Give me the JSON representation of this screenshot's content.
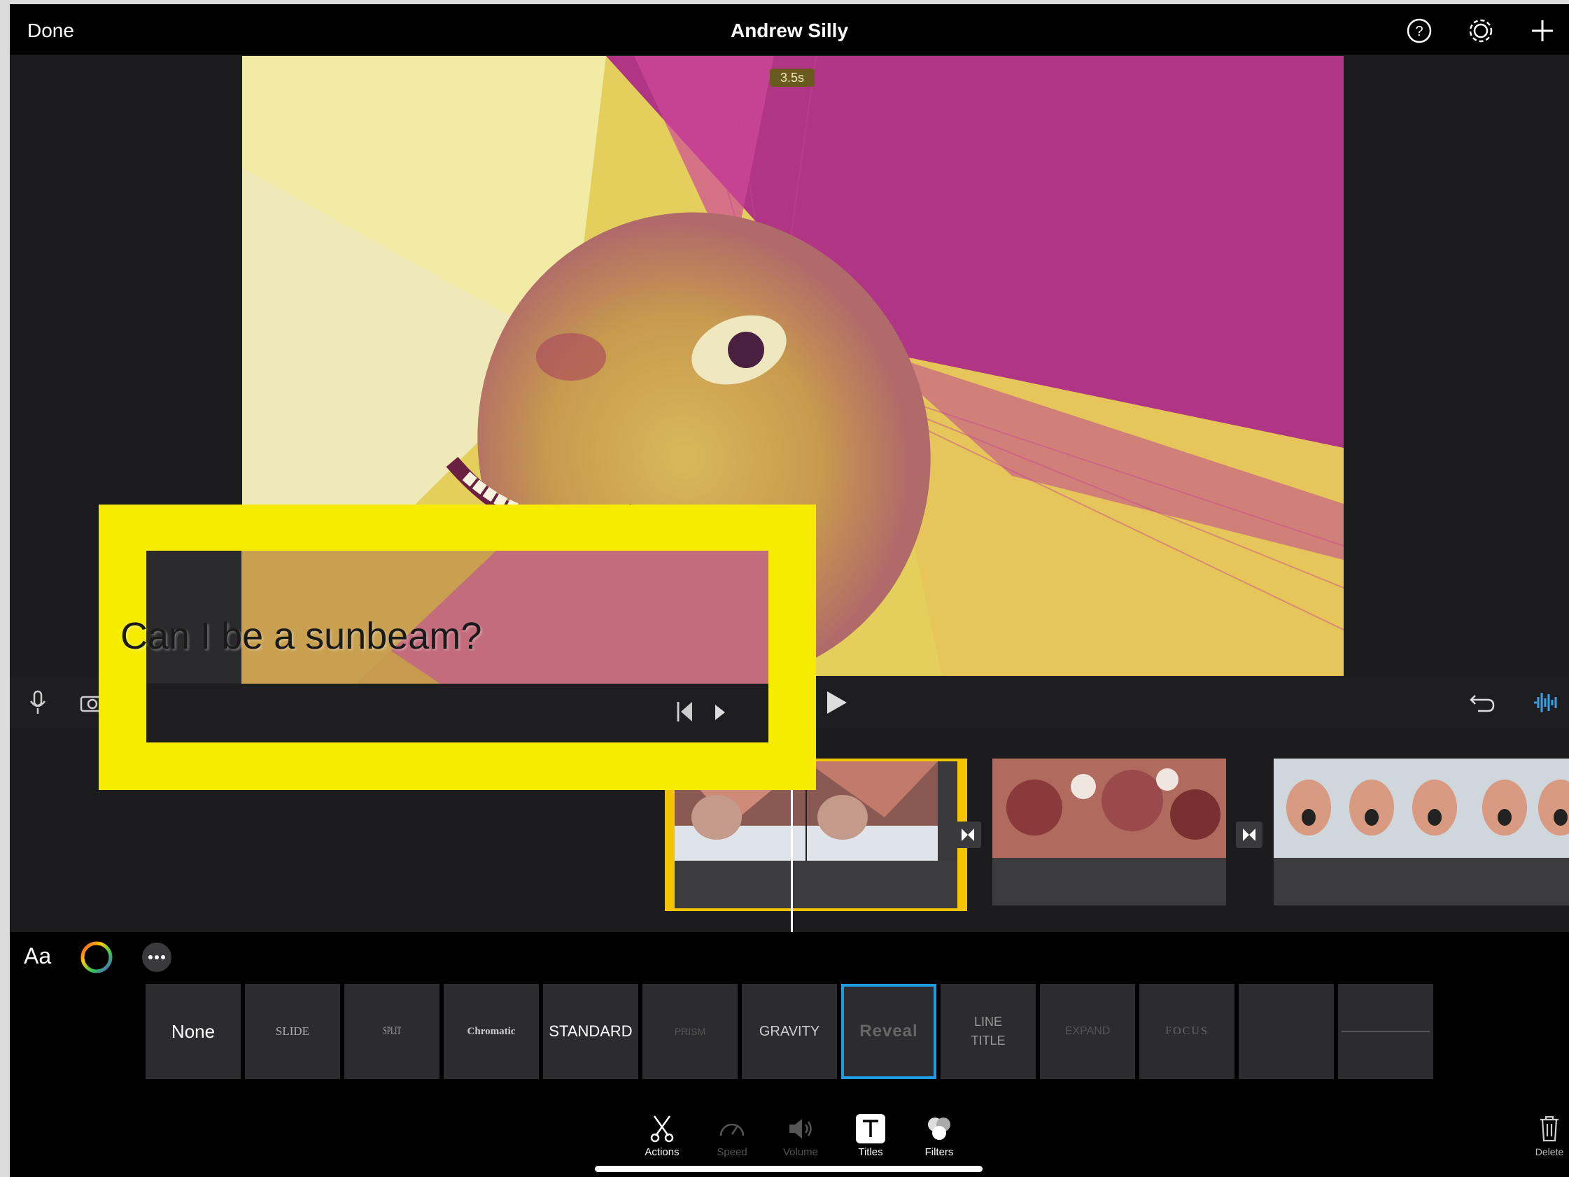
{
  "topbar": {
    "done_label": "Done",
    "project_title": "Andrew Silly",
    "icons": [
      "help-icon",
      "settings-icon",
      "add-icon"
    ]
  },
  "viewer": {
    "duration_badge": "3.5s",
    "title_text": "Can I be a sunbeam?",
    "colors": {
      "yellow": "#e8cd56",
      "magenta": "#b23a86"
    }
  },
  "controls": {
    "icons": [
      "microphone-icon",
      "camera-icon",
      "skip-to-start-icon",
      "play-icon",
      "undo-icon",
      "audio-waveform-icon"
    ]
  },
  "title_tools": {
    "font_label": "Aa",
    "icons": [
      "color-picker-icon",
      "more-options-icon"
    ]
  },
  "title_styles": [
    {
      "label": "None"
    },
    {
      "label": "SLIDE"
    },
    {
      "label": "SPLIT"
    },
    {
      "label": "Chromatic"
    },
    {
      "label": "STANDARD"
    },
    {
      "label": "PRISM"
    },
    {
      "label": "GRAVITY"
    },
    {
      "label": "Reveal"
    },
    {
      "label": "LINE\nTITLE"
    },
    {
      "label": "EXPAND"
    },
    {
      "label": "FOCUS"
    },
    {
      "label": ""
    },
    {
      "label": ""
    }
  ],
  "selected_style": "Reveal",
  "bottom_tabs": [
    {
      "label": "Actions",
      "icon": "scissors-icon"
    },
    {
      "label": "Speed",
      "icon": "speedometer-icon"
    },
    {
      "label": "Volume",
      "icon": "speaker-icon"
    },
    {
      "label": "Titles",
      "icon": "titles-icon"
    },
    {
      "label": "Filters",
      "icon": "filters-icon"
    }
  ],
  "delete_label": "Delete",
  "highlight_color": "#f7ec00"
}
